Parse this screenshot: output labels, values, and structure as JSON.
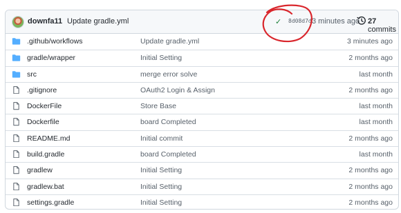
{
  "header": {
    "author": "downfa11",
    "message": "Update gradle.yml",
    "check": "✓",
    "sha": "8d08d7d",
    "time": "3 minutes ago",
    "commits_count": "27",
    "commits_label": "commits"
  },
  "files": [
    {
      "type": "folder",
      "name": ".github/workflows",
      "message": "Update gradle.yml",
      "age": "3 minutes ago"
    },
    {
      "type": "folder",
      "name": "gradle/wrapper",
      "message": "Initial Setting",
      "age": "2 months ago"
    },
    {
      "type": "folder",
      "name": "src",
      "message": "merge error solve",
      "age": "last month"
    },
    {
      "type": "file",
      "name": ".gitignore",
      "message": "OAuth2 Login & Assign",
      "age": "2 months ago"
    },
    {
      "type": "file",
      "name": "DockerFile",
      "message": "Store Base",
      "age": "last month"
    },
    {
      "type": "file",
      "name": "Dockerfile",
      "message": "board Completed",
      "age": "last month"
    },
    {
      "type": "file",
      "name": "README.md",
      "message": "Initial commit",
      "age": "2 months ago"
    },
    {
      "type": "file",
      "name": "build.gradle",
      "message": "board Completed",
      "age": "last month"
    },
    {
      "type": "file",
      "name": "gradlew",
      "message": "Initial Setting",
      "age": "2 months ago"
    },
    {
      "type": "file",
      "name": "gradlew.bat",
      "message": "Initial Setting",
      "age": "2 months ago"
    },
    {
      "type": "file",
      "name": "settings.gradle",
      "message": "Initial Setting",
      "age": "2 months ago"
    }
  ],
  "colors": {
    "folder": "#54aeff",
    "file_stroke": "#57606a",
    "check": "#1a7f37",
    "annotation": "#d9262c"
  },
  "icons": {
    "folder": "folder-icon",
    "file": "file-icon",
    "history": "history-icon"
  }
}
